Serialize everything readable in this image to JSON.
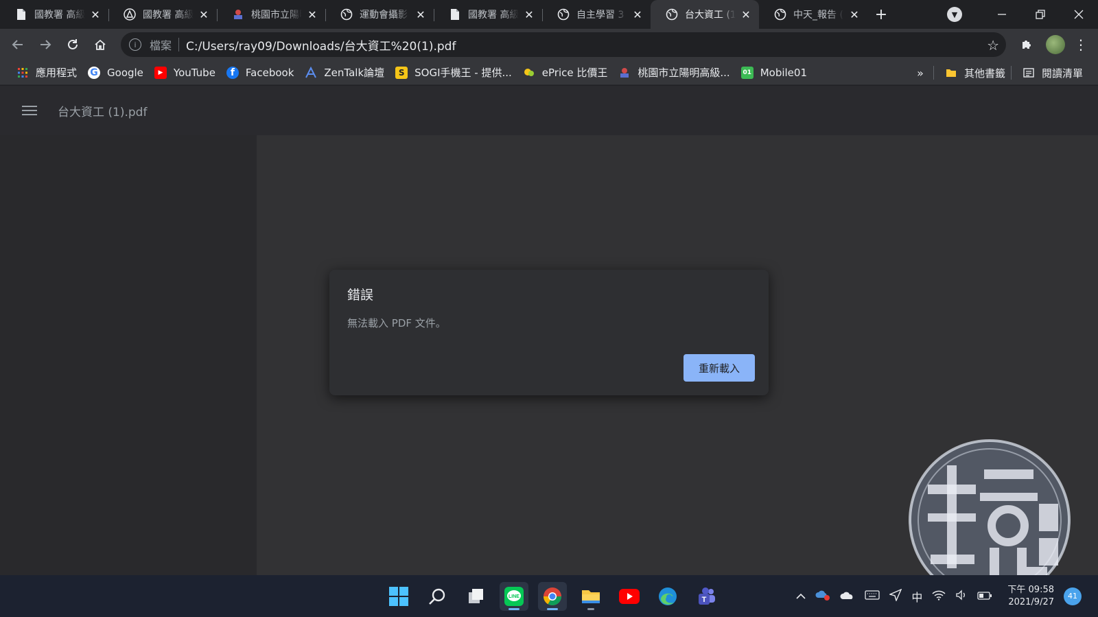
{
  "tabs": [
    {
      "title": "國教署 高級",
      "icon": "document-icon"
    },
    {
      "title": "國教署 高級",
      "icon": "triangle-logo-icon"
    },
    {
      "title": "桃園市立陽明",
      "icon": "school-logo-icon"
    },
    {
      "title": "運動會攝影",
      "icon": "globe-icon"
    },
    {
      "title": "國教署 高級",
      "icon": "document-icon"
    },
    {
      "title": "自主學習 3",
      "icon": "globe-icon"
    },
    {
      "title": "台大資工 (1",
      "icon": "globe-icon",
      "active": true
    },
    {
      "title": "中天_報告 (",
      "icon": "globe-icon"
    }
  ],
  "toolbar": {
    "scheme": "檔案",
    "url": "C:/Users/ray09/Downloads/台大資工%20(1).pdf"
  },
  "bookmarks": [
    {
      "label": "應用程式",
      "icon": "apps-grid-icon",
      "color": "#ea4335"
    },
    {
      "label": "Google",
      "icon": "google-icon",
      "color": "#ffffff"
    },
    {
      "label": "YouTube",
      "icon": "youtube-icon",
      "color": "#ff0000"
    },
    {
      "label": "Facebook",
      "icon": "facebook-icon",
      "color": "#1877f2"
    },
    {
      "label": "ZenTalk論壇",
      "icon": "zentalk-icon",
      "color": "#5b8def"
    },
    {
      "label": "SOGI手機王 - 提供...",
      "icon": "sogi-icon",
      "color": "#f5c518"
    },
    {
      "label": "ePrice 比價王",
      "icon": "eprice-icon",
      "color": "#f5c518"
    },
    {
      "label": "桃園市立陽明高級...",
      "icon": "school-logo-icon",
      "color": "#d04a4a"
    },
    {
      "label": "Mobile01",
      "icon": "mobile01-icon",
      "color": "#3cba54"
    }
  ],
  "bookmarks_right": {
    "overflow": "»",
    "other": "其他書籤",
    "reading_list": "閱讀清單"
  },
  "pdf": {
    "doc_title": "台大資工 (1).pdf"
  },
  "dialog": {
    "title": "錯誤",
    "message": "無法載入 PDF 文件。",
    "button": "重新載入"
  },
  "taskbar": {
    "input_method": "中",
    "time": "下午 09:58",
    "date": "2021/9/27",
    "notifications": "41"
  },
  "colors": {
    "accent": "#8ab4f8",
    "tab_active": "#35363a",
    "background": "#202124"
  }
}
